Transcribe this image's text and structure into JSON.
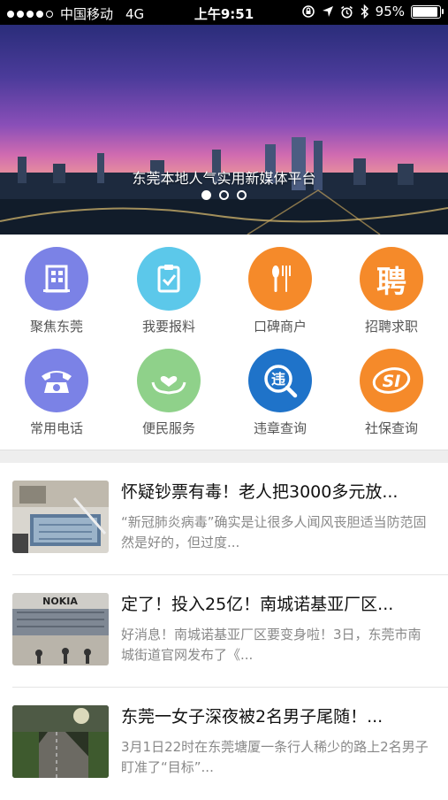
{
  "status_bar": {
    "carrier": "中国移动",
    "network": "4G",
    "time": "上午9:51",
    "battery": "95%",
    "battery_level": 0.95
  },
  "banner": {
    "caption": "东莞本地人气实用新媒体平台",
    "page_count": 3,
    "active_page": 1
  },
  "shortcuts": [
    {
      "label": "聚焦东莞",
      "icon": "building-icon",
      "color": "#7b82e6"
    },
    {
      "label": "我要报料",
      "icon": "clipboard-check-icon",
      "color": "#5cc8ea"
    },
    {
      "label": "口碑商户",
      "icon": "fork-knife-icon",
      "color": "#f58a2a"
    },
    {
      "label": "招聘求职",
      "icon": "recruit-char-icon",
      "color": "#f58a2a",
      "glyph": "聘"
    },
    {
      "label": "常用电话",
      "icon": "telephone-icon",
      "color": "#7b82e6"
    },
    {
      "label": "便民服务",
      "icon": "heart-hands-icon",
      "color": "#8fd18a"
    },
    {
      "label": "违章查询",
      "icon": "violation-search-icon",
      "color": "#1f73c9",
      "glyph": "违"
    },
    {
      "label": "社保查询",
      "icon": "social-security-icon",
      "color": "#f58a2a",
      "glyph": "SI"
    }
  ],
  "news": [
    {
      "title": "怀疑钞票有毒！老人把3000多元放...",
      "summary": "“新冠肺炎病毒”确实是让很多人闻风丧胆适当防范固然是好的，但过度...",
      "thumb": "money-drying-thumb"
    },
    {
      "title": "定了！投入25亿！南城诺基亚厂区...",
      "summary": "好消息！南城诺基亚厂区要变身啦！3日，东莞市南城街道官网发布了《...",
      "thumb": "nokia-building-thumb",
      "thumb_text": "NOKIA"
    },
    {
      "title": "东莞一女子深夜被2名男子尾随！...",
      "summary": "3月1日22时在东莞塘厦一条行人稀少的路上2名男子盯准了“目标”...",
      "thumb": "night-street-thumb"
    }
  ]
}
